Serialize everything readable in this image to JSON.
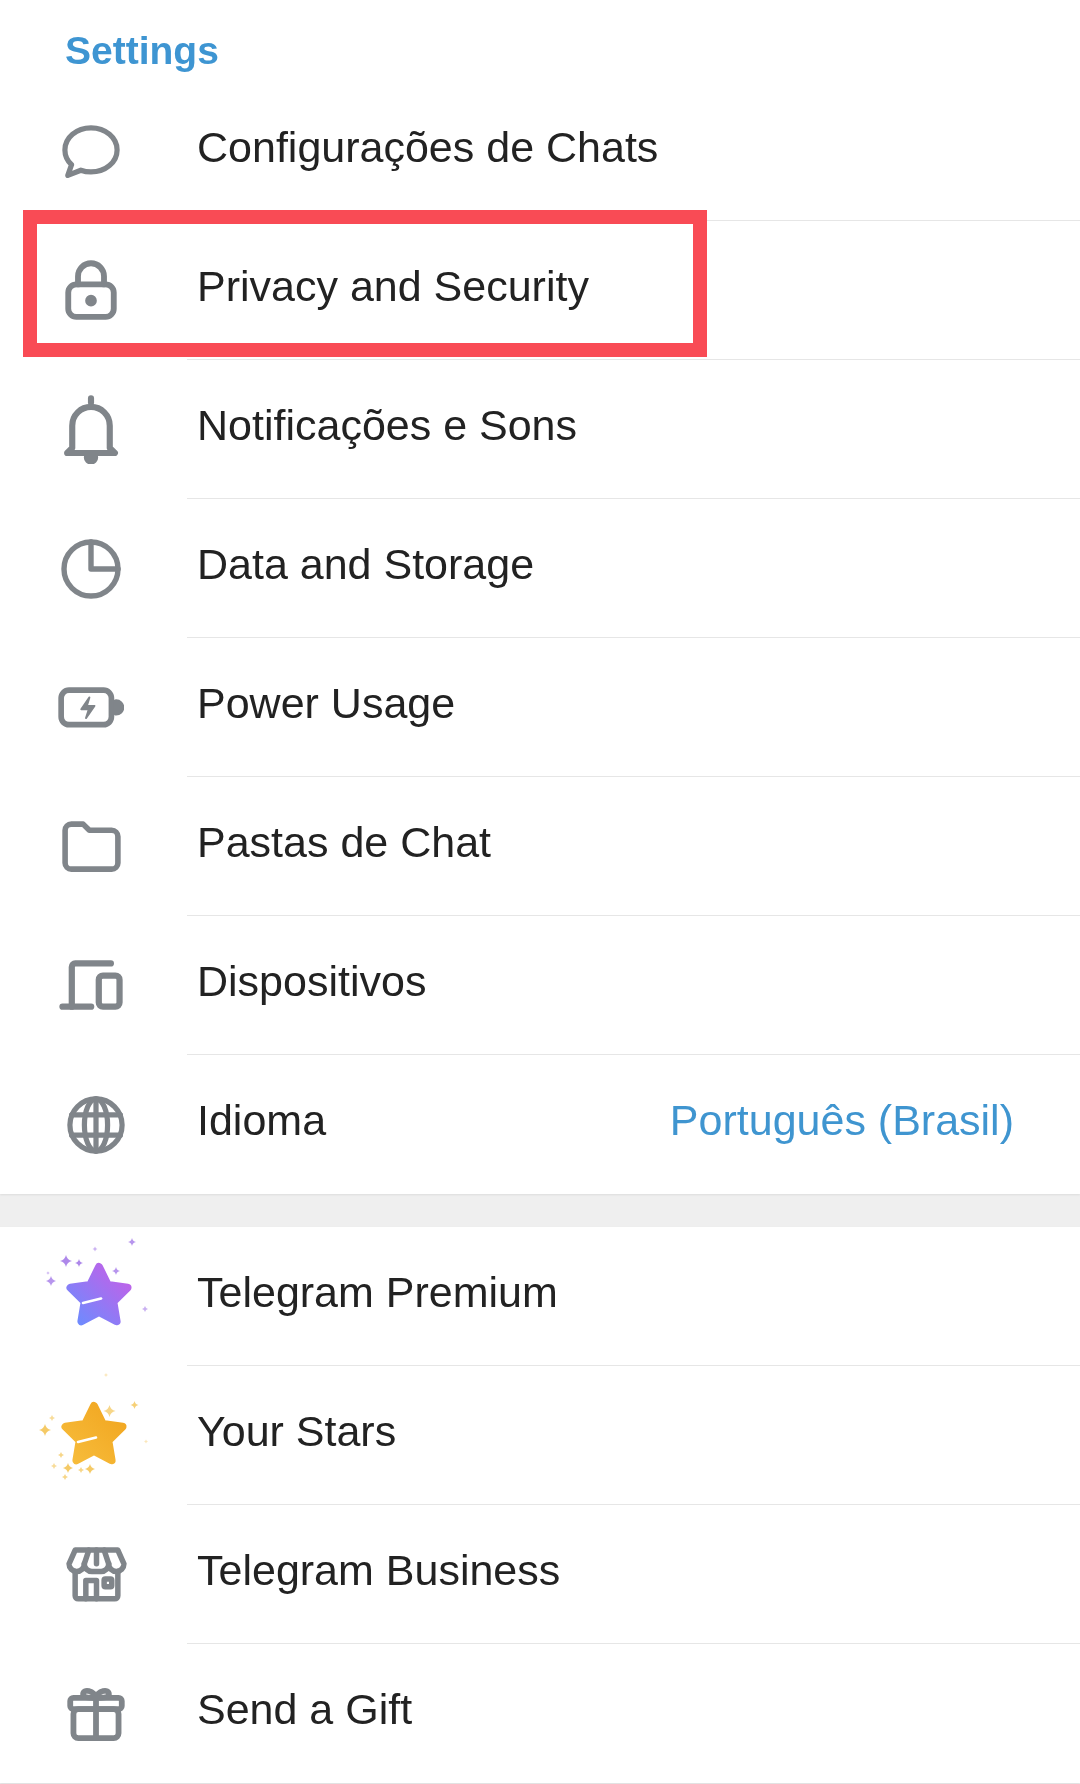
{
  "title": "Settings",
  "sections": [
    {
      "items": [
        {
          "label": "Configurações de Chats",
          "highlighted": false
        },
        {
          "label": "Privacy and Security",
          "highlighted": true
        },
        {
          "label": "Notificações e Sons",
          "highlighted": false
        },
        {
          "label": "Data and Storage",
          "highlighted": false
        },
        {
          "label": "Power Usage",
          "highlighted": false
        },
        {
          "label": "Pastas de Chat",
          "highlighted": false
        },
        {
          "label": "Dispositivos",
          "highlighted": false
        },
        {
          "label": "Idioma",
          "value": "Português (Brasil)",
          "highlighted": false
        }
      ]
    },
    {
      "items": [
        {
          "label": "Telegram Premium",
          "highlighted": false
        },
        {
          "label": "Your Stars",
          "highlighted": false
        },
        {
          "label": "Telegram Business",
          "highlighted": false
        },
        {
          "label": "Send a Gift",
          "highlighted": false
        }
      ]
    }
  ]
}
